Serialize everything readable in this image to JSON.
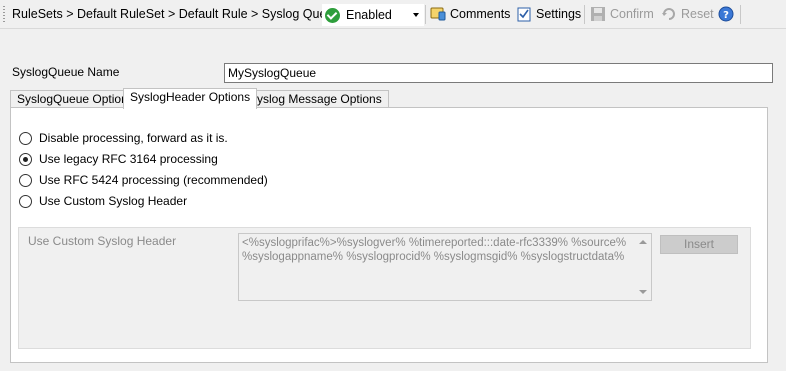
{
  "toolbar": {
    "breadcrumb": "RuleSets > Default RuleSet > Default Rule > Syslog Queue",
    "status_value": "Enabled",
    "comments_label": "Comments",
    "settings_label": "Settings",
    "confirm_label": "Confirm",
    "reset_label": "Reset",
    "icons": [
      "check-circle-icon",
      "comments-icon",
      "settings-icon",
      "save-icon",
      "reset-icon",
      "help-icon"
    ]
  },
  "form": {
    "name_label": "SyslogQueue Name",
    "name_value": "MySyslogQueue"
  },
  "tabs": [
    {
      "label": "SyslogQueue Options",
      "active": false
    },
    {
      "label": "SyslogHeader Options",
      "active": true
    },
    {
      "label": "Syslog Message Options",
      "active": false
    }
  ],
  "header_options": {
    "radios": [
      {
        "label": "Disable processing, forward as it is.",
        "checked": false
      },
      {
        "label": "Use legacy RFC 3164 processing",
        "checked": true
      },
      {
        "label": "Use RFC 5424 processing (recommended)",
        "checked": false
      },
      {
        "label": "Use Custom Syslog Header",
        "checked": false
      }
    ],
    "custom_header_label": "Use Custom Syslog Header",
    "custom_header_template": "<%syslogprifac%>%syslogver% %timereported:::date-rfc3339% %source% %syslogappname% %syslogprocid% %syslogmsgid% %syslogstructdata%",
    "insert_label": "Insert"
  }
}
